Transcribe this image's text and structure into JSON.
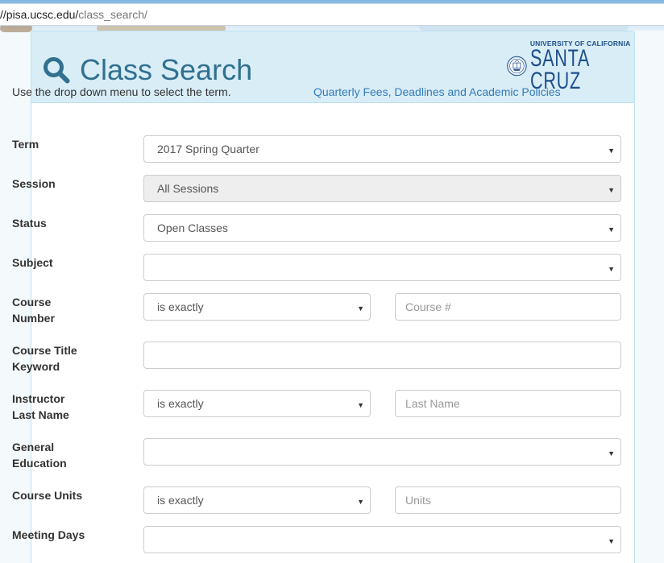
{
  "browser": {
    "url_host": "//pisa.ucsc.edu/",
    "url_path": "class_search/"
  },
  "header": {
    "title": "Class Search",
    "logo_top": "UNIVERSITY OF CALIFORNIA",
    "logo_main": "SANTA CRUZ",
    "accent": "#31708f",
    "background": "#d9edf7"
  },
  "intro": {
    "instruction": "Use the drop down menu to select the term.",
    "link": "Quarterly Fees, Deadlines and Academic Policies"
  },
  "form": {
    "term": {
      "label": "Term",
      "value": "2017 Spring Quarter"
    },
    "session": {
      "label": "Session",
      "value": "All Sessions"
    },
    "status": {
      "label": "Status",
      "value": "Open Classes"
    },
    "subject": {
      "label": "Subject",
      "value": ""
    },
    "course_number": {
      "label_line1": "Course",
      "label_line2": "Number",
      "operator": "is exactly",
      "placeholder": "Course #"
    },
    "course_title": {
      "label_line1": "Course Title",
      "label_line2": "Keyword",
      "value": ""
    },
    "instructor": {
      "label_line1": "Instructor",
      "label_line2": "Last Name",
      "operator": "is exactly",
      "placeholder": "Last Name"
    },
    "gen_ed": {
      "label_line1": "General",
      "label_line2": "Education",
      "value": ""
    },
    "units": {
      "label": "Course Units",
      "operator": "is exactly",
      "placeholder": "Units"
    },
    "meeting_days": {
      "label": "Meeting Days",
      "value": ""
    }
  },
  "icons": {
    "search": "search-icon",
    "caret": "chevron-down-icon",
    "seal": "ucsc-seal-icon"
  }
}
